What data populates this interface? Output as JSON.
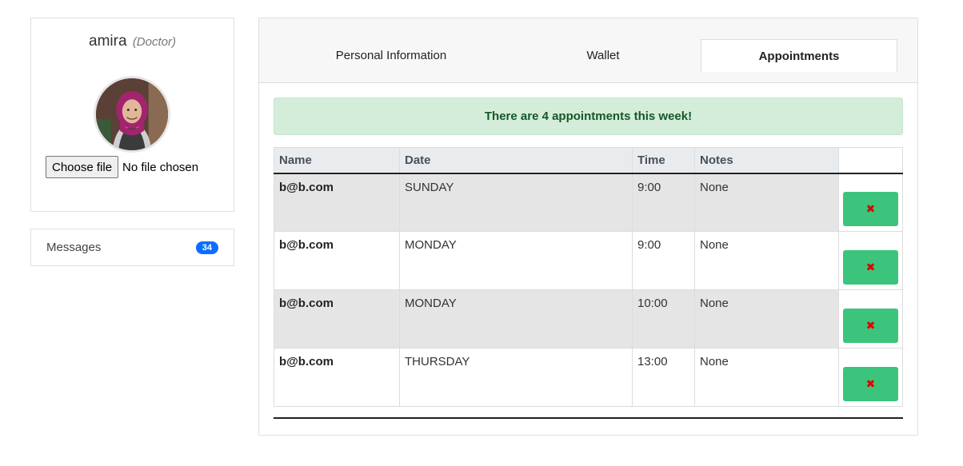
{
  "profile": {
    "name": "amira",
    "role": "(Doctor)",
    "file_button_label": "Choose file",
    "file_status": "No file chosen"
  },
  "messages": {
    "label": "Messages",
    "count": "34"
  },
  "tabs": [
    {
      "label": "Personal Information",
      "active": false
    },
    {
      "label": "Wallet",
      "active": false
    },
    {
      "label": "Appointments",
      "active": true
    }
  ],
  "alert": {
    "text": "There are 4 appointments this week!"
  },
  "table": {
    "headers": [
      "Name",
      "Date",
      "Time",
      "Notes"
    ],
    "rows": [
      {
        "name": "b@b.com",
        "date": "SUNDAY",
        "time": "9:00",
        "notes": "None"
      },
      {
        "name": "b@b.com",
        "date": "MONDAY",
        "time": "9:00",
        "notes": "None"
      },
      {
        "name": "b@b.com",
        "date": "MONDAY",
        "time": "10:00",
        "notes": "None"
      },
      {
        "name": "b@b.com",
        "date": "THURSDAY",
        "time": "13:00",
        "notes": "None"
      }
    ],
    "delete_glyph": "✖"
  },
  "colors": {
    "alert_bg": "#d4eddb",
    "alert_text": "#155724",
    "badge": "#0d6efd",
    "delete_button": "#3cc47c",
    "delete_glyph": "#e00000"
  }
}
